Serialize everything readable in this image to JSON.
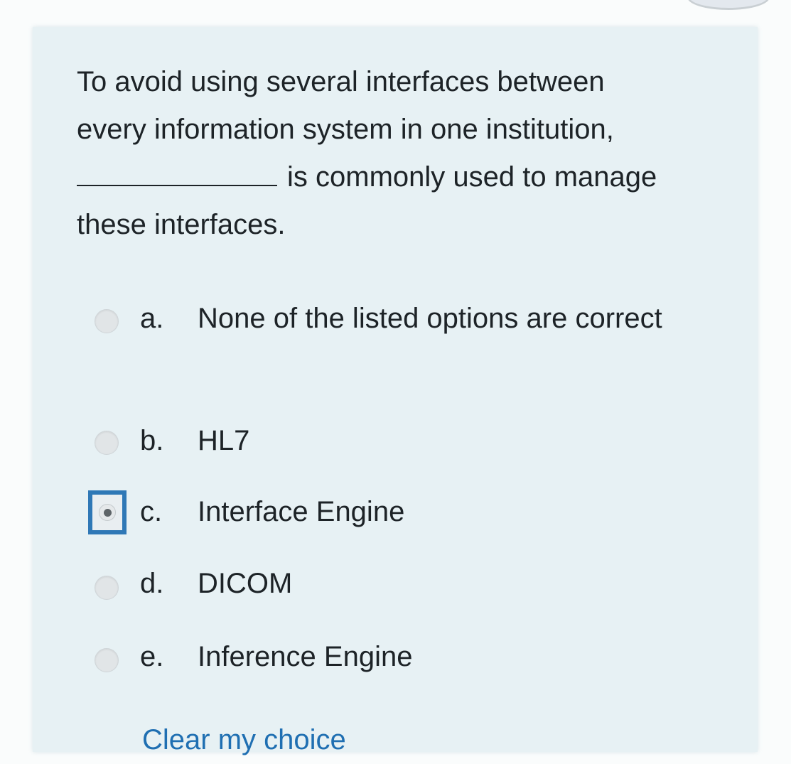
{
  "question": {
    "line1": "To avoid using several interfaces between",
    "line2": "every information system in one institution,",
    "line3": "is commonly used to manage",
    "line4": "these interfaces."
  },
  "options": [
    {
      "letter": "a.",
      "text": "None of the listed options are correct",
      "selected": false
    },
    {
      "letter": "b.",
      "text": "HL7",
      "selected": false
    },
    {
      "letter": "c.",
      "text": "Interface Engine",
      "selected": true
    },
    {
      "letter": "d.",
      "text": "DICOM",
      "selected": false
    },
    {
      "letter": "e.",
      "text": "Inference Engine",
      "selected": false
    }
  ],
  "clear_link": "Clear my choice",
  "colors": {
    "card_background": "#e7f1f4",
    "selected_focus": "#2f78b6",
    "link": "#1f6fb2"
  }
}
